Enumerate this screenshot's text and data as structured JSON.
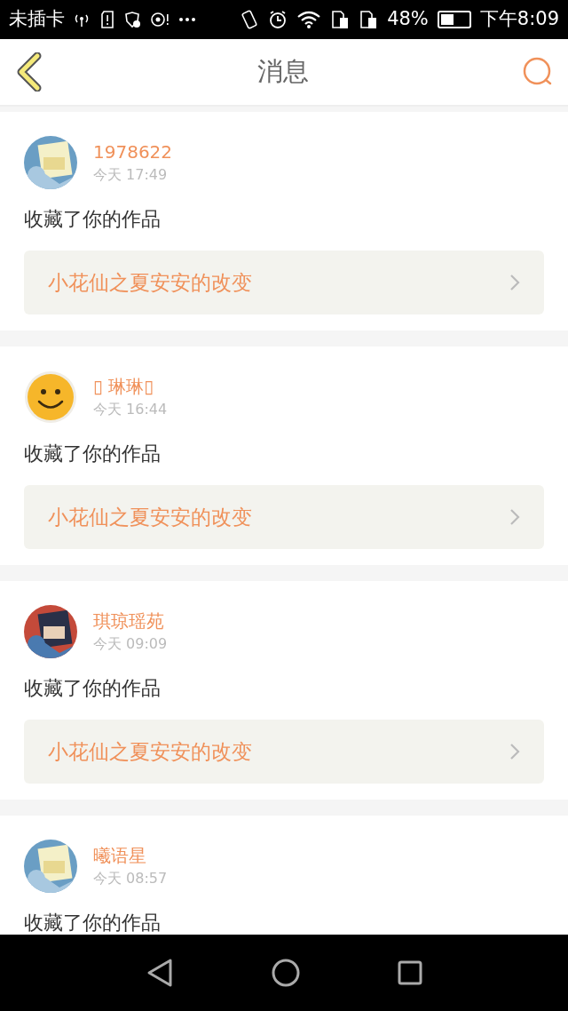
{
  "status_bar": {
    "carrier": "未插卡",
    "battery_text": "48%",
    "time": "下午8:09"
  },
  "header": {
    "title": "消息"
  },
  "messages": [
    {
      "user": "1978622",
      "time": "今天 17:49",
      "action": "收藏了你的作品",
      "work": "小花仙之夏安安的改变"
    },
    {
      "user": "▯ 琳琳▯",
      "time": "今天 16:44",
      "avatar": {
        "kind": "smiley"
      },
      "action": "收藏了你的作品",
      "work": "小花仙之夏安安的改变"
    },
    {
      "user": "琪琼瑶苑",
      "time": "今天 09:09",
      "action": "收藏了你的作品",
      "work": "小花仙之夏安安的改变"
    },
    {
      "user": "曦语星",
      "time": "今天 08:57",
      "action": "收藏了你的作品"
    }
  ]
}
